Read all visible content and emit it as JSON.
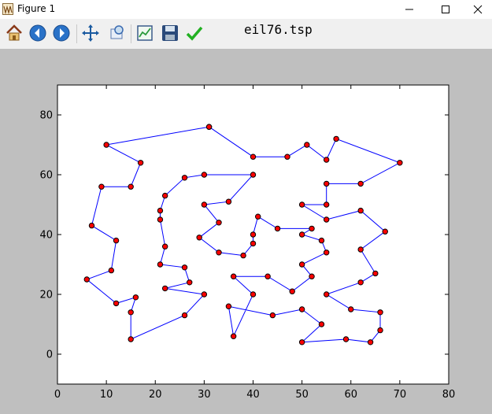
{
  "window": {
    "title": "Figure 1"
  },
  "toolbar": {
    "buttons": [
      {
        "name": "home-button",
        "icon": "home-icon"
      },
      {
        "name": "back-button",
        "icon": "back-arrow-icon"
      },
      {
        "name": "forward-button",
        "icon": "forward-arrow-icon"
      },
      {
        "name": "pan-button",
        "icon": "pan-arrows-icon"
      },
      {
        "name": "zoom-button",
        "icon": "zoom-rect-icon"
      },
      {
        "name": "subplots-button",
        "icon": "subplots-icon"
      },
      {
        "name": "save-button",
        "icon": "floppy-disk-icon"
      },
      {
        "name": "edit-axis-button",
        "icon": "checkmark-icon"
      }
    ]
  },
  "figure_title": "eil76.tsp",
  "chart_data": {
    "type": "line",
    "title": "eil76.tsp",
    "xlim": [
      0,
      80
    ],
    "ylim": [
      -10,
      90
    ],
    "xticks": [
      0,
      10,
      20,
      30,
      40,
      50,
      60,
      70,
      80
    ],
    "yticks": [
      0,
      20,
      40,
      60,
      80
    ],
    "grid": false,
    "line_color": "#0000ff",
    "marker_face": "#ff0000",
    "marker_edge": "#000000",
    "series": [
      {
        "x": [
          31,
          40,
          47,
          51,
          55,
          57,
          70,
          62,
          55,
          55,
          50,
          55,
          62,
          67,
          62,
          65,
          62,
          55,
          60,
          66,
          66,
          64,
          59,
          50,
          54,
          50,
          44,
          35,
          36,
          40,
          36,
          43,
          48,
          52,
          50,
          55,
          54,
          50,
          52,
          45,
          41,
          40,
          40,
          38,
          33,
          29,
          33,
          30,
          35,
          40,
          30,
          26,
          22,
          21,
          21,
          22,
          21,
          26,
          27,
          22,
          30,
          26,
          15,
          15,
          16,
          12,
          6,
          11,
          12,
          7,
          9,
          15,
          17,
          10,
          31
        ],
        "y": [
          76,
          66,
          66,
          70,
          65,
          72,
          64,
          57,
          57,
          50,
          50,
          45,
          48,
          41,
          35,
          27,
          24,
          20,
          15,
          14,
          8,
          4,
          5,
          4,
          10,
          15,
          13,
          16,
          6,
          20,
          26,
          26,
          21,
          26,
          30,
          34,
          38,
          40,
          42,
          42,
          46,
          40,
          37,
          33,
          34,
          39,
          44,
          50,
          51,
          60,
          60,
          59,
          53,
          48,
          45,
          36,
          30,
          29,
          24,
          22,
          20,
          13,
          5,
          14,
          19,
          17,
          25,
          28,
          38,
          43,
          56,
          56,
          64,
          70,
          76
        ]
      }
    ]
  }
}
